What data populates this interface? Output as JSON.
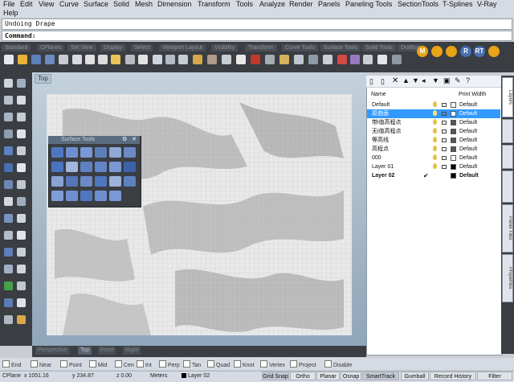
{
  "menu": [
    "File",
    "Edit",
    "View",
    "Curve",
    "Surface",
    "Solid",
    "Mesh",
    "Dimension",
    "Transform",
    "Tools",
    "Analyze",
    "Render",
    "Panels",
    "Paneling Tools",
    "SectionTools",
    "T-Splines",
    "V-Ray",
    "Help"
  ],
  "command": {
    "history": "Undoing Drape",
    "prompt": "Command:"
  },
  "toolbar_tabs": [
    "Standard",
    "CPlanes",
    "Set View",
    "Display",
    "Select",
    "Viewport Layout",
    "Visibility",
    "Transform",
    "Curve Tools",
    "Surface Tools",
    "Solid Tools",
    "Drafting"
  ],
  "vray_buttons": [
    "M",
    "",
    "",
    "R",
    "RT",
    ""
  ],
  "viewport": {
    "label": "Top"
  },
  "floating_panel": {
    "title": "Surface Tools"
  },
  "layers": {
    "headers": {
      "name": "Name",
      "material": "Print Width"
    },
    "rows": [
      {
        "name": "Default",
        "material": "Default",
        "color": "#ffffff",
        "selected": false,
        "current": false
      },
      {
        "name": "原曲面",
        "material": "Default",
        "color": "#ffffff",
        "selected": true,
        "current": false
      },
      {
        "name": "带i值高程点",
        "material": "Default",
        "color": "#555555",
        "selected": false,
        "current": false
      },
      {
        "name": "无i值高程点",
        "material": "Default",
        "color": "#555555",
        "selected": false,
        "current": false
      },
      {
        "name": "等高线",
        "material": "Default",
        "color": "#555555",
        "selected": false,
        "current": false
      },
      {
        "name": "高程点",
        "material": "Default",
        "color": "#555555",
        "selected": false,
        "current": false
      },
      {
        "name": "000",
        "material": "Default",
        "color": "#ffffff",
        "selected": false,
        "current": false
      },
      {
        "name": "Layer 01",
        "material": "Default",
        "color": "#000000",
        "selected": false,
        "current": false
      },
      {
        "name": "Layer 02",
        "material": "Default",
        "color": "#000000",
        "selected": false,
        "current": true
      }
    ],
    "current_mark": "✔"
  },
  "side_tabs": [
    "Layers",
    "",
    "",
    "",
    "Panel Tiles",
    "Properties"
  ],
  "viewport_tabs": [
    "Perspective",
    "Top",
    "Front",
    "Right"
  ],
  "osnaps": [
    {
      "label": "End",
      "checked": false
    },
    {
      "label": "Near",
      "checked": false
    },
    {
      "label": "Point",
      "checked": false
    },
    {
      "label": "Mid",
      "checked": false
    },
    {
      "label": "Cen",
      "checked": false
    },
    {
      "label": "Int",
      "checked": false
    },
    {
      "label": "Perp",
      "checked": false
    },
    {
      "label": "Tan",
      "checked": false
    },
    {
      "label": "Quad",
      "checked": false
    },
    {
      "label": "Knot",
      "checked": false
    },
    {
      "label": "Vertex",
      "checked": false
    },
    {
      "label": "Project",
      "checked": false
    },
    {
      "label": "Disable",
      "checked": false
    }
  ],
  "status": {
    "cplane": "CPlane",
    "x": "x 1051.16",
    "y": "y 234.87",
    "z": "z 0.00",
    "units": "Meters",
    "layer": "Layer 02",
    "panes": [
      "Grid Snap",
      "Ortho",
      "Planar",
      "Osnap",
      "SmartTrack",
      "Gumball",
      "Record History",
      "Filter"
    ]
  },
  "colors": {
    "accent": "#3399ff",
    "vray": "#e8a316"
  }
}
